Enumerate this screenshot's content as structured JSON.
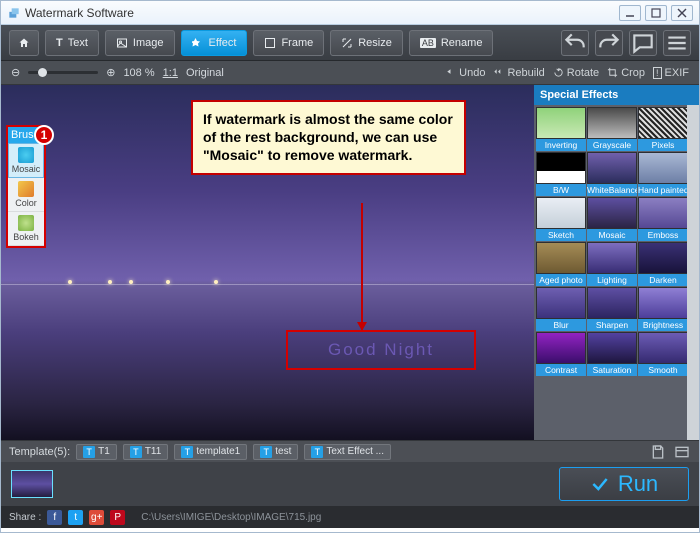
{
  "window": {
    "title": "Watermark Software"
  },
  "toolbar": {
    "text": "Text",
    "image": "Image",
    "effect": "Effect",
    "frame": "Frame",
    "resize": "Resize",
    "rename": "Rename"
  },
  "zoombar": {
    "percent": "108 %",
    "ratio": "1:1",
    "original": "Original",
    "undo": "Undo",
    "rebuild": "Rebuild",
    "rotate": "Rotate",
    "crop": "Crop",
    "exif": "EXIF"
  },
  "brush": {
    "header": "Brus",
    "badge": "1",
    "mosaic": "Mosaic",
    "color": "Color",
    "bokeh": "Bokeh"
  },
  "annotation": {
    "text": "If watermark is almost the same color of the rest background, we can use \"Mosaic\" to remove watermark."
  },
  "watermark_text": "Good Night",
  "effects": {
    "header": "Special Effects",
    "items": [
      "Inverting",
      "Grayscale",
      "Pixels",
      "B/W",
      "WhiteBalance",
      "Hand painted",
      "Sketch",
      "Mosaic",
      "Emboss",
      "Aged photo",
      "Lighting",
      "Darken",
      "Blur",
      "Sharpen",
      "Brightness",
      "Contrast",
      "Saturation",
      "Smooth"
    ],
    "thumbs": [
      "linear-gradient(#8fd27a,#c9e9b5)",
      "linear-gradient(#4a4a4a,#bdbdbd)",
      "repeating-linear-gradient(45deg,#222,#222 2px,#ddd 2px,#ddd 4px)",
      "linear-gradient(#000 0 60%,#fff 60% 100%)",
      "linear-gradient(#7060ac,#2b2d5c)",
      "linear-gradient(#a9b8d4,#6d7fa6)",
      "linear-gradient(#e9eef4,#c5cfd9)",
      "linear-gradient(#5d4fa1,#2b2444)",
      "linear-gradient(#8b7fc2,#564894)",
      "linear-gradient(#a58c56,#6e5a32)",
      "linear-gradient(#7d6ec0,#382d74)",
      "linear-gradient(#3a3175,#18133a)",
      "linear-gradient(#6e5fb1,#3c327c)",
      "linear-gradient(#5e4fa3,#2c2460)",
      "linear-gradient(#8f7fd4,#4d3e9a)",
      "linear-gradient(#9223c2,#3b0e6c)",
      "linear-gradient(#5342a1,#1e163f)",
      "linear-gradient(#6c5cb5,#352a70)"
    ]
  },
  "templates": {
    "label": "Template(5):",
    "items": [
      "T1",
      "T11",
      "template1",
      "test",
      "Text Effect ..."
    ]
  },
  "run": {
    "label": "Run"
  },
  "share": {
    "label": "Share :",
    "path": "C:\\Users\\IMIGE\\Desktop\\IMAGE\\715.jpg"
  }
}
